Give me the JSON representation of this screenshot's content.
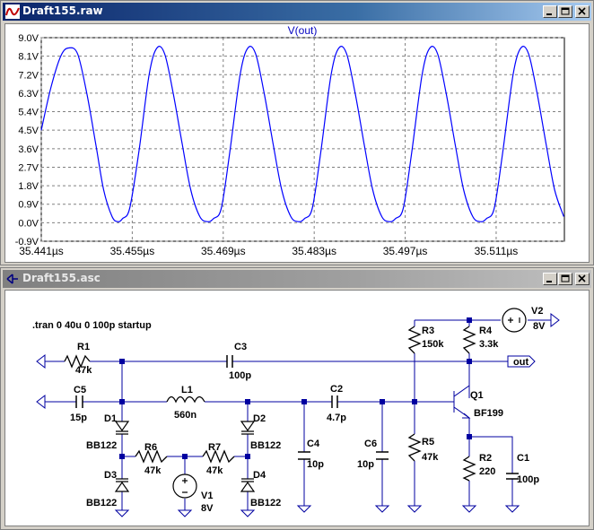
{
  "waveform_window": {
    "title": "Draft155.raw",
    "plot_title": "V(out)",
    "y_ticks": [
      "9.0V",
      "8.1V",
      "7.2V",
      "6.3V",
      "5.4V",
      "4.5V",
      "3.6V",
      "2.7V",
      "1.8V",
      "0.9V",
      "0.0V",
      "-0.9V"
    ],
    "x_ticks": [
      "35.441µs",
      "35.455µs",
      "35.469µs",
      "35.483µs",
      "35.497µs",
      "35.511µs"
    ]
  },
  "chart_data": {
    "type": "line",
    "title": "V(out)",
    "xlabel": "",
    "ylabel": "",
    "x_unit": "µs",
    "xlim": [
      35.441,
      35.5215
    ],
    "ylim": [
      -0.9,
      9.0
    ],
    "grid": true,
    "series": [
      {
        "name": "V(out)",
        "color": "#0000ff",
        "x": [
          35.441,
          35.4425,
          35.444,
          35.4452,
          35.4466,
          35.448,
          35.4494,
          35.4506,
          35.4519,
          35.4528,
          35.4535,
          35.4546,
          35.456,
          35.4576,
          35.4588,
          35.46,
          35.4613,
          35.4627,
          35.464,
          35.4654,
          35.4666,
          35.4675,
          35.4687,
          35.47,
          35.4716,
          35.4728,
          35.474,
          35.4753,
          35.4767,
          35.478,
          35.4794,
          35.4806,
          35.4815,
          35.4827,
          35.484,
          35.4856,
          35.4868,
          35.488,
          35.4893,
          35.4907,
          35.492,
          35.4934,
          35.4946,
          35.4955,
          35.4967,
          35.498,
          35.4996,
          35.5008,
          35.502,
          35.5033,
          35.5047,
          35.506,
          35.5074,
          35.5086,
          35.5095,
          35.5107,
          35.512,
          35.5136,
          35.5148,
          35.516,
          35.5173,
          35.5187,
          35.52,
          35.5214
        ],
        "y": [
          4.5,
          6.6,
          8.1,
          8.5,
          8.2,
          6.3,
          3.8,
          1.6,
          0.3,
          0.05,
          0.2,
          0.7,
          3.4,
          7.2,
          8.5,
          8.2,
          6.3,
          3.8,
          1.6,
          0.3,
          0.05,
          0.2,
          0.7,
          3.4,
          7.2,
          8.5,
          8.2,
          6.3,
          3.8,
          1.6,
          0.3,
          0.05,
          0.2,
          0.7,
          3.4,
          7.2,
          8.5,
          8.2,
          6.3,
          3.8,
          1.6,
          0.3,
          0.05,
          0.2,
          0.7,
          3.4,
          7.2,
          8.5,
          8.2,
          6.3,
          3.8,
          1.6,
          0.3,
          0.05,
          0.2,
          0.7,
          3.4,
          7.2,
          8.5,
          8.2,
          6.3,
          3.8,
          1.6,
          0.3
        ]
      }
    ]
  },
  "schematic_window": {
    "title": "Draft155.asc",
    "directive": ".tran 0 40u 0 100p startup",
    "net_out": "out",
    "components": {
      "R1": {
        "name": "R1",
        "value": "47k"
      },
      "R2": {
        "name": "R2",
        "value": "220"
      },
      "R3": {
        "name": "R3",
        "value": "150k"
      },
      "R4": {
        "name": "R4",
        "value": "3.3k"
      },
      "R5": {
        "name": "R5",
        "value": "47k"
      },
      "R6": {
        "name": "R6",
        "value": "47k"
      },
      "R7": {
        "name": "R7",
        "value": "47k"
      },
      "C1": {
        "name": "C1",
        "value": "100p"
      },
      "C2": {
        "name": "C2",
        "value": "4.7p"
      },
      "C3": {
        "name": "C3",
        "value": "100p"
      },
      "C4": {
        "name": "C4",
        "value": "10p"
      },
      "C5": {
        "name": "C5",
        "value": "15p"
      },
      "C6": {
        "name": "C6",
        "value": "10p"
      },
      "L1": {
        "name": "L1",
        "value": "560n"
      },
      "D1": {
        "name": "D1",
        "value": "BB122"
      },
      "D2": {
        "name": "D2",
        "value": "BB122"
      },
      "D3": {
        "name": "D3",
        "value": "BB122"
      },
      "D4": {
        "name": "D4",
        "value": "BB122"
      },
      "Q1": {
        "name": "Q1",
        "value": "BF199"
      },
      "V1": {
        "name": "V1",
        "value": "8V"
      },
      "V2": {
        "name": "V2",
        "value": "8V"
      }
    }
  }
}
